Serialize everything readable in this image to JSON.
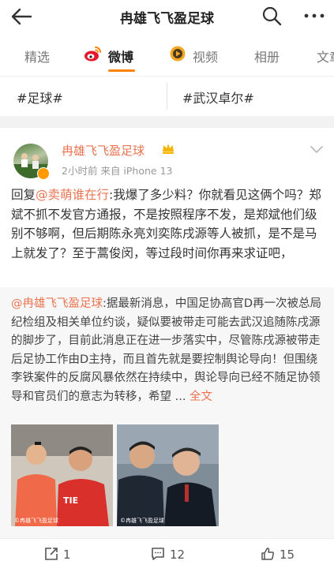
{
  "header": {
    "title": "冉雄飞飞盈足球",
    "back_icon": "back-arrow-icon",
    "search_icon": "search-icon",
    "more_icon": "more-icon"
  },
  "tabs": [
    {
      "label": "精选"
    },
    {
      "label": "微博",
      "icon": "weibo-icon"
    },
    {
      "label": "视频",
      "icon": "video-icon"
    },
    {
      "label": "相册"
    },
    {
      "label": "文章"
    }
  ],
  "topics": [
    "#足球#",
    "#武汉卓尔#"
  ],
  "post": {
    "username": "冉雄飞飞盈足球",
    "meta": "2小时前  来自 iPhone 13",
    "reply_prefix": "回复",
    "reply_to": "@卖萌谁在行",
    "text": ":我爆了多少料？你就看见这俩个吗？郑斌不抓不发官方通报，不是按照程序不发，是郑斌他们级别不够啊，但后期陈永亮刘奕陈戌源等人被抓，是不是马上就发了？至于蒿俊闵，等过段时间你再来求证吧，",
    "quote": {
      "author": "@冉雄飞飞盈足球",
      "text": ":据最新消息，中国足协高官D再一次被总局纪检组及相关单位约谈，疑似要被带走可能去武汉追随陈戌源的脚步了，目前此消息正在进一步落实中，尽管陈戌源被带走后足协工作由D主持，而且首先就是要控制舆论导向！但围绕李铁案件的反腐风暴依然在持续中，舆论导向已经不随足协领导和官员们的意志为转移，希望 ... ",
      "more_link": "全文",
      "watermark": "©冉雄飞飞盈足球"
    }
  },
  "actions": [
    {
      "icon": "repost-icon",
      "count": "1"
    },
    {
      "icon": "comment-icon",
      "count": "12"
    },
    {
      "icon": "like-icon",
      "count": "15"
    }
  ],
  "colors": {
    "accent": "#ff8200",
    "link": "#eb7350"
  }
}
